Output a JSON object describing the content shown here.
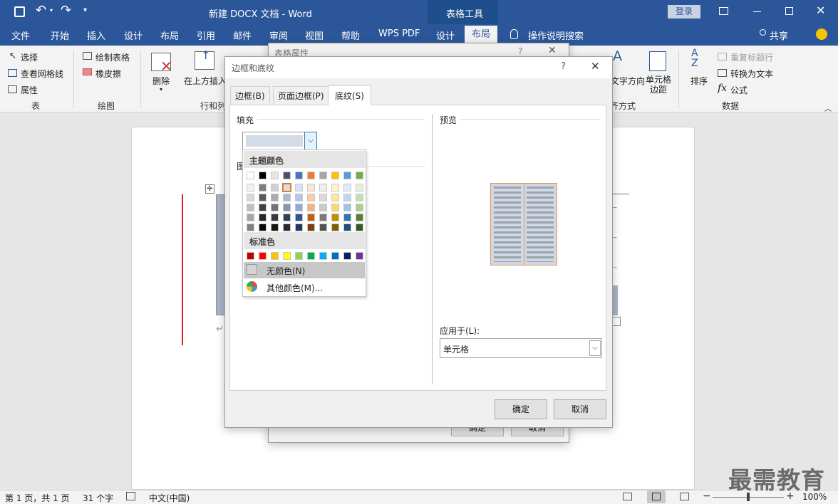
{
  "titlebar": {
    "title": "新建 DOCX 文档 - Word",
    "context_group": "表格工具",
    "login": "登录"
  },
  "tabs": {
    "file": "文件",
    "home": "开始",
    "insert": "插入",
    "design": "设计",
    "layout": "布局",
    "references": "引用",
    "mailings": "邮件",
    "review": "审阅",
    "view": "视图",
    "help": "帮助",
    "wps": "WPS PDF",
    "table_design": "设计",
    "table_layout": "布局",
    "tellme": "操作说明搜索",
    "share": "共享"
  },
  "ribbon": {
    "select": "选择",
    "view_grid": "查看网格线",
    "properties": "属性",
    "group_table": "表",
    "draw_table": "绘制表格",
    "eraser": "橡皮擦",
    "group_draw": "绘图",
    "delete": "删除",
    "insert_above": "在上方插入",
    "group_rows": "行和列",
    "text_direction": "文字方向",
    "cell_margins": "单元格\n边距",
    "group_align": "齐方式",
    "sort": "排序",
    "repeat_header": "重复标题行",
    "convert_text": "转换为文本",
    "formula": "公式",
    "group_data": "数据"
  },
  "bg_dialog": {
    "title": "表格属性",
    "ok": "确定",
    "cancel": "取消"
  },
  "dialog": {
    "title": "边框和底纹",
    "help": "?",
    "tabs": [
      "边框(B)",
      "页面边框(P)",
      "底纹(S)"
    ],
    "fill_label": "填充",
    "pattern_label": "图",
    "preview_label": "预览",
    "apply_label": "应用于(L):",
    "apply_value": "单元格",
    "ok": "确定",
    "cancel": "取消"
  },
  "palette": {
    "theme_header": "主题颜色",
    "standard_header": "标准色",
    "no_color": "无颜色(N)",
    "more_colors": "其他颜色(M)...",
    "theme_top": [
      "#ffffff",
      "#000000",
      "#e7e6e6",
      "#44546a",
      "#4472c4",
      "#ed7d31",
      "#a5a5a5",
      "#ffc000",
      "#5b9bd5",
      "#70ad47"
    ],
    "theme_shades": [
      [
        "#f2f2f2",
        "#7f7f7f",
        "#d0cece",
        "#d6dce5",
        "#d9e2f3",
        "#fbe5d6",
        "#ededed",
        "#fff2cc",
        "#deebf7",
        "#e2f0d9"
      ],
      [
        "#d9d9d9",
        "#595959",
        "#aeabab",
        "#adb9ca",
        "#b4c7e7",
        "#f8cbad",
        "#dbdbdb",
        "#ffe699",
        "#bdd7ee",
        "#c5e0b4"
      ],
      [
        "#bfbfbf",
        "#404040",
        "#757171",
        "#8497b0",
        "#8faadc",
        "#f4b183",
        "#c9c9c9",
        "#ffd966",
        "#9dc3e6",
        "#a9d18e"
      ],
      [
        "#a6a6a6",
        "#262626",
        "#3b3838",
        "#333f50",
        "#2f5597",
        "#c55a11",
        "#7b7b7b",
        "#bf9000",
        "#2e75b6",
        "#548235"
      ],
      [
        "#808080",
        "#0d0d0d",
        "#171616",
        "#222a35",
        "#1f3864",
        "#843c0c",
        "#525252",
        "#7f6000",
        "#1f4e79",
        "#385723"
      ]
    ],
    "standard": [
      "#c00000",
      "#ff0000",
      "#ffc000",
      "#ffff00",
      "#92d050",
      "#00b050",
      "#00b0f0",
      "#0070c0",
      "#002060",
      "#7030a0"
    ]
  },
  "status": {
    "page": "第 1 页，共 1 页",
    "words": "31 个字",
    "lang": "中文(中国)",
    "zoom": "100%"
  },
  "watermark": "最需教育"
}
